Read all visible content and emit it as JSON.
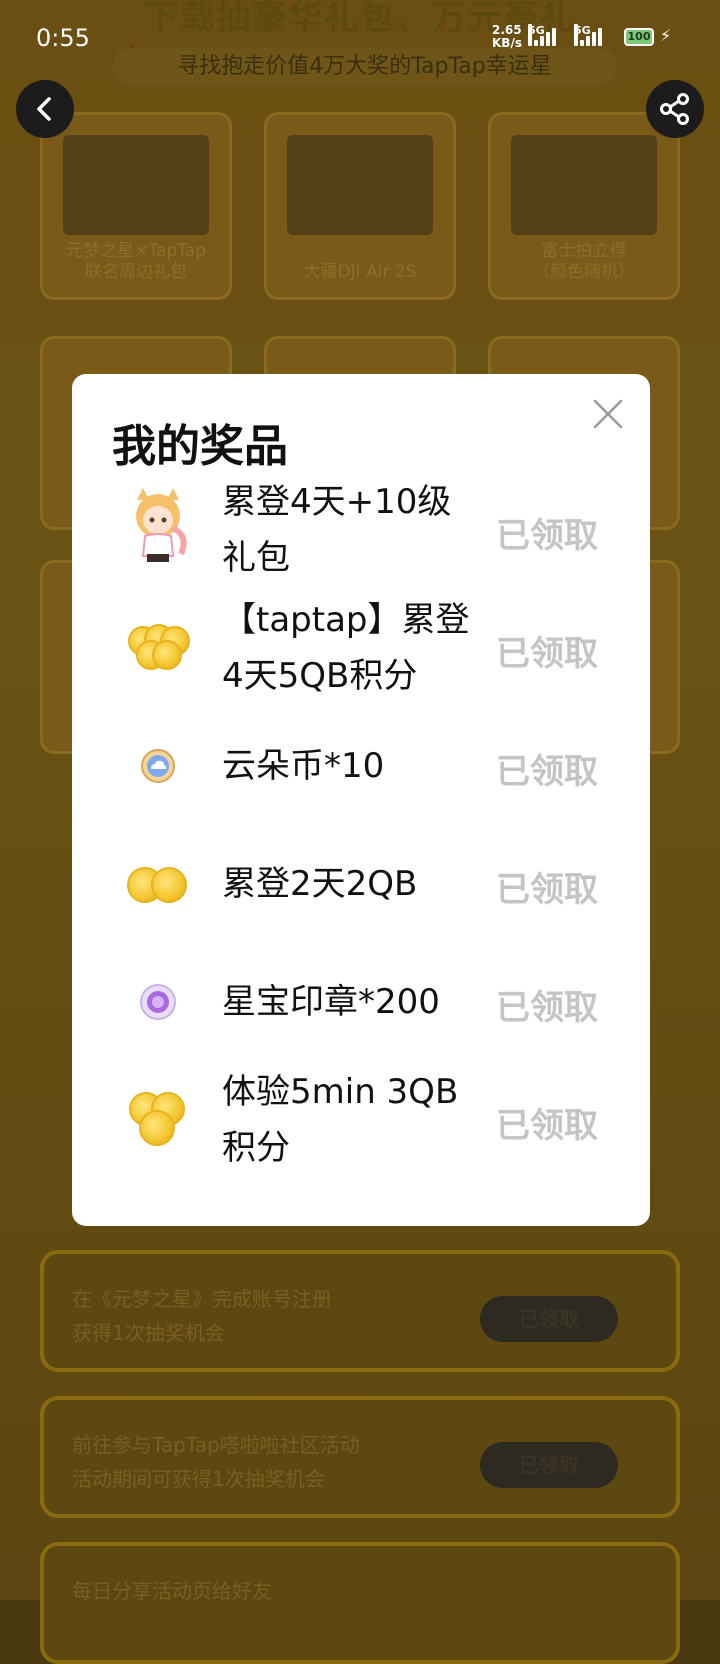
{
  "status_bar": {
    "time": "0:55",
    "net_speed_line1": "2.65",
    "net_speed_line2": "KB/s",
    "net_label_1": "5G",
    "net_label_2": "5G",
    "battery": "100"
  },
  "background": {
    "banner_title": "下载抽豪华礼包、万元豪礼",
    "banner_subtitle": "寻找抱走价值4万大奖的TapTap幸运星",
    "prize_cards": [
      {
        "caption": "元梦之星×TapTap\n联名周边礼包"
      },
      {
        "caption": "大疆DJI Air 2S"
      },
      {
        "caption": "富士拍立得\n（颜色随机）"
      }
    ],
    "tasks": [
      {
        "text": "在《元梦之星》完成账号注册\n获得1次抽奖机会",
        "button": "已领取"
      },
      {
        "text": "前往参与TapTap嗒啦啦社区活动\n活动期间可获得1次抽奖机会",
        "button": "已领取"
      },
      {
        "text": "每日分享活动页给好友",
        "button": ""
      }
    ]
  },
  "modal": {
    "title": "我的奖品",
    "prizes": [
      {
        "name": "累登4天+10级礼包",
        "status": "已领取",
        "icon": "character-icon"
      },
      {
        "name": "【taptap】累登4天5QB积分",
        "status": "已领取",
        "icon": "coins-stack-icon"
      },
      {
        "name": "云朵币*10",
        "status": "已领取",
        "icon": "cloud-coin-icon"
      },
      {
        "name": "累登2天2QB",
        "status": "已领取",
        "icon": "two-coins-icon"
      },
      {
        "name": "星宝印章*200",
        "status": "已领取",
        "icon": "star-seal-icon"
      },
      {
        "name": "体验5min 3QB积分",
        "status": "已领取",
        "icon": "three-coins-icon"
      }
    ]
  },
  "colors": {
    "modal_bg": "#ffffff",
    "claimed_text": "#c4c4c4",
    "overlay_tint": "#6b4f12"
  }
}
